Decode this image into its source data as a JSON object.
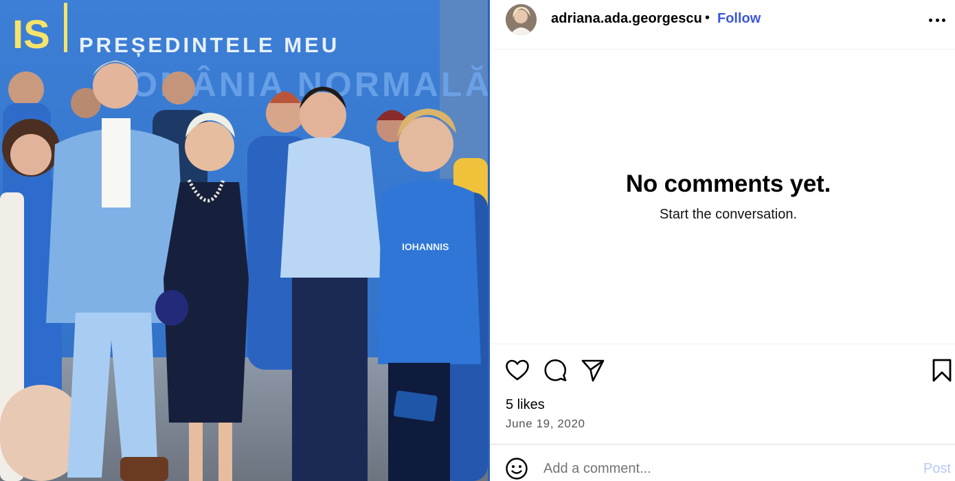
{
  "post": {
    "username": "adriana.ada.georgescu",
    "separator": "•",
    "follow_label": "Follow",
    "more_icon": "more-horizontal-icon",
    "avatar_icon": "profile-avatar"
  },
  "photo": {
    "banner_line1": "PREȘEDINTELE MEU",
    "banner_line2": "ROMÂNIA NORMALĂ",
    "banner_logo_fragment": "IS",
    "shirt_text": "IOHANNIS",
    "colors": {
      "banner_blue": "#3d7fd6",
      "shirt_blue": "#2f6cc9",
      "banner_text": "#e8f1ff",
      "logo_yellow": "#f6e36a"
    }
  },
  "comments": {
    "empty_title": "No comments yet.",
    "empty_subtitle": "Start the conversation."
  },
  "actions": {
    "icons": [
      "heart-icon",
      "comment-icon",
      "share-icon",
      "bookmark-icon"
    ],
    "likes_text": "5 likes",
    "date_text": "June 19, 2020"
  },
  "comment_box": {
    "placeholder": "Add a comment...",
    "post_label": "Post",
    "emoji_icon": "emoji-icon"
  },
  "colors": {
    "follow": "#3b57d9",
    "post_disabled": "#b6c8f8",
    "divider": "#efefef"
  }
}
